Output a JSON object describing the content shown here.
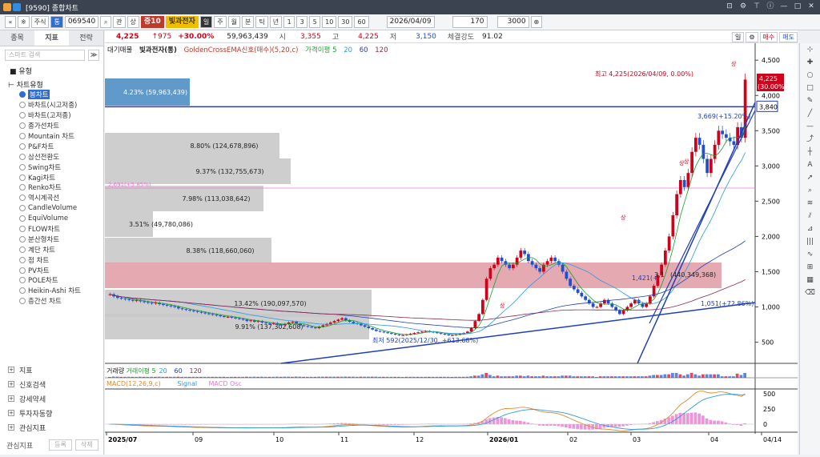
{
  "window": {
    "title": "[9590] 종합차트"
  },
  "toolbar": {
    "nav_prev": "«",
    "nav_pin": "※",
    "market": "주식",
    "code_flag": "통",
    "code": "069540",
    "search_icon": "⌕",
    "btn_gwan": "관",
    "btn_sang": "상",
    "badge": "증10",
    "stock_name": "빛과전자",
    "btn_il": "일",
    "btn_ju": "주",
    "btn_wol": "월",
    "btn_bun": "분",
    "btn_tick": "틱",
    "btn_nyeon": "년",
    "periods": [
      "1",
      "3",
      "5",
      "10",
      "30",
      "60"
    ],
    "date": "2026/04/09",
    "count": "170",
    "count2": "3000"
  },
  "left": {
    "tabs": [
      "종목",
      "지표",
      "전략"
    ],
    "search_placeholder": "스마트 검색",
    "group": "유형",
    "sub": "차트유형",
    "chart_types": [
      "봉차트",
      "바차트(시고저종)",
      "바차트(고저종)",
      "종가선차트",
      "Mountain 차트",
      "P&F차트",
      "삼선전환도",
      "Swing차트",
      "Kagi차트",
      "Renko차트",
      "역시계곡선",
      "CandleVolume",
      "EquiVolume",
      "FLOW차트",
      "분산형차트",
      "계단 차트",
      "점 차트",
      "PV차트",
      "POLE차트",
      "Heikin-Ashi 차트",
      "층간선 차트"
    ],
    "selected_index": 0,
    "bottom": [
      "지표",
      "신호검색",
      "강세약세",
      "투자자동향",
      "관심지표"
    ],
    "foot_label": "관심지표",
    "foot_b1": "등록",
    "foot_b2": "삭제"
  },
  "quote": {
    "price": "4,225",
    "change": "↑975",
    "pct": "+30.00%",
    "volume": "59,963,439",
    "open_l": "시",
    "open": "3,355",
    "high_l": "고",
    "high": "4,225",
    "low_l": "저",
    "low": "3,150",
    "strength_l": "체결강도",
    "strength": "91.02",
    "day": "일",
    "buy": "매수",
    "sell": "매도"
  },
  "legend": {
    "items": [
      "대기매물",
      "빛과전자(통)",
      "GoldenCrossEMA신호(매수)(5,20,c)",
      "가격이평 5",
      "20",
      "60",
      "120"
    ]
  },
  "colors": {
    "up": "#d0021b",
    "down": "#1f4fd0",
    "ma5": "#1a9e2a",
    "ma20": "#2c9ae0",
    "ma60": "#1f3fb8",
    "ma120": "#8a2a4f",
    "vp": "#c9c9c9",
    "vp_hl": "#e2a0a8",
    "vp_top": "#4f8fc4"
  },
  "chart_data": {
    "type": "candlestick",
    "y_ticks": [
      "4,500",
      "4,000",
      "3,500",
      "3,000",
      "2,500",
      "2,000",
      "1,500",
      "1,000",
      "500"
    ],
    "ylim": [
      200,
      4650
    ],
    "x_ticks": [
      "2025/07",
      "09",
      "10",
      "11",
      "12",
      "2026/01",
      "02",
      "03",
      "04",
      "04/14"
    ],
    "closes": [
      1180,
      1150,
      1130,
      1120,
      1110,
      1100,
      1090,
      1095,
      1080,
      1070,
      1060,
      1050,
      1060,
      1040,
      1030,
      1020,
      1010,
      1000,
      980,
      970,
      960,
      950,
      940,
      930,
      920,
      910,
      900,
      890,
      880,
      870,
      860,
      860,
      850,
      840,
      830,
      820,
      800,
      810,
      790,
      800,
      780,
      770,
      760,
      770,
      750,
      740,
      760,
      780,
      790,
      760,
      740,
      730,
      720,
      710,
      700,
      720,
      740,
      760,
      780,
      800,
      820,
      840,
      810,
      790,
      770,
      760,
      740,
      720,
      700,
      680,
      660,
      650,
      640,
      630,
      620,
      610,
      600,
      600,
      610,
      620,
      630,
      640,
      650,
      660,
      650,
      640,
      630,
      620,
      610,
      600,
      600,
      610,
      620,
      630,
      650,
      700,
      800,
      900,
      1100,
      1400,
      1550,
      1600,
      1700,
      1650,
      1600,
      1550,
      1600,
      1700,
      1800,
      1750,
      1650,
      1600,
      1550,
      1500,
      1600,
      1650,
      1700,
      1650,
      1600,
      1500,
      1400,
      1300,
      1250,
      1200,
      1150,
      1100,
      1050,
      1000,
      1000,
      1050,
      1100,
      1050,
      1000,
      950,
      900,
      950,
      1000,
      1050,
      1100,
      1050,
      1000,
      1050,
      1150,
      1300,
      1450,
      1600,
      1800,
      2000,
      2300,
      2600,
      2800,
      2700,
      2900,
      3200,
      3400,
      3300,
      3100,
      2900,
      3100,
      3300,
      3500,
      3450,
      3400,
      3350,
      3300,
      3550,
      3400,
      4225
    ],
    "volume_profile": [
      {
        "label": "4.23% (59,963,439)"
      },
      {
        "label": "8.80% (124,678,896)"
      },
      {
        "label": "9.37% (132,755,673)"
      },
      {
        "label": "7.98% (113,038,642)"
      },
      {
        "label": "3.51% (49,780,086)"
      },
      {
        "label": "8.38% (118,660,060)"
      },
      {
        "label": ""
      },
      {
        "label": "13.42% (190,097,570)"
      },
      {
        "label": "9.91% (137,302,608)"
      }
    ],
    "annotations": {
      "max": "최고 4,225(2026/04/09, 0.00%)",
      "min": "최저 592(2025/12/30, +613.68%)",
      "a1": "3,669(+15.20%)",
      "a2": "1,421(+",
      "a3": "3,1",
      "a4": "(440,349,368)",
      "a5": "1,051(+72.86%)",
      "hline": "3,840",
      "last": "4,225",
      "last_pct": "(30.00%)",
      "sang": "상",
      "pink_label": "2,691(+5.85%)"
    },
    "volume_legend": [
      "거래량",
      "거래이평 5",
      "20",
      "60",
      "120"
    ],
    "macd_legend": [
      "MACD(12,26,9,c)",
      "Signal",
      "MACD Osc"
    ],
    "macd_ticks": [
      "500",
      "250",
      "0"
    ]
  }
}
